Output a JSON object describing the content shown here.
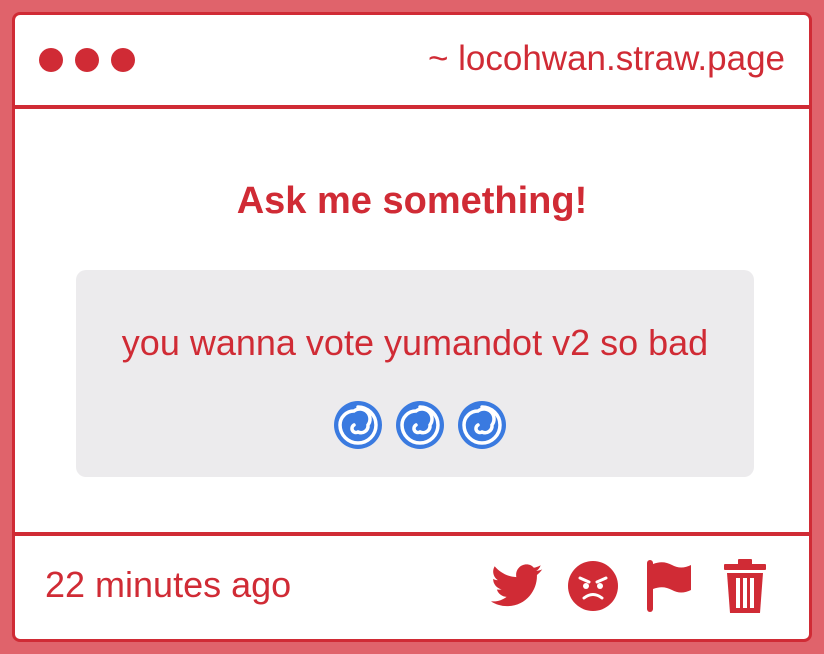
{
  "window": {
    "url": "~ locohwan.straw.page"
  },
  "prompt": {
    "title": "Ask me something!"
  },
  "question": {
    "text": "you wanna vote yumandot v2 so bad",
    "emoji": [
      "cyclone-icon",
      "cyclone-icon",
      "cyclone-icon"
    ]
  },
  "footer": {
    "timestamp": "22 minutes ago",
    "actions": [
      "twitter-icon",
      "angry-face-icon",
      "flag-icon",
      "trash-icon"
    ]
  },
  "colors": {
    "accent": "#d02b35",
    "question_bg": "#ecebed",
    "cyclone": "#3a7ae0"
  }
}
